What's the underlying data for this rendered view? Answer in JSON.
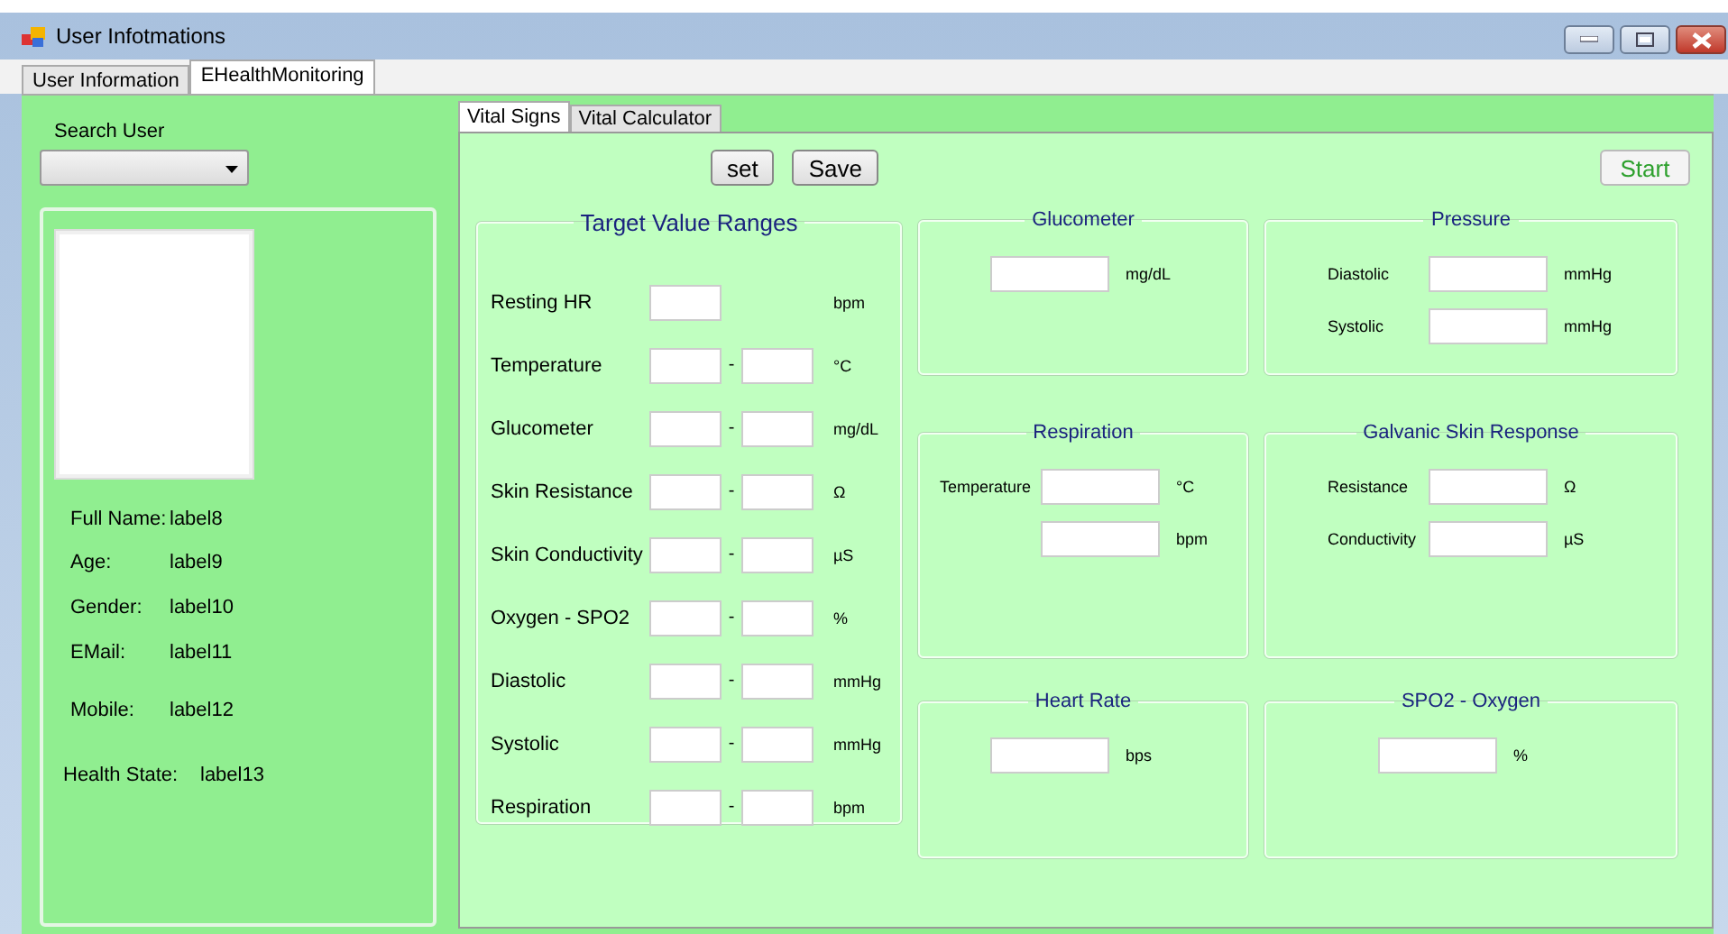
{
  "window": {
    "title": "User Infotmations",
    "controls": [
      {
        "kind": "minimize"
      },
      {
        "kind": "maximize"
      },
      {
        "kind": "close"
      }
    ]
  },
  "tabs": [
    {
      "label": "User Information",
      "selected": false
    },
    {
      "label": "EHealthMonitoring",
      "selected": true
    }
  ],
  "user_panel": {
    "search_label": "Search User",
    "info": [
      {
        "label": "Full Name:",
        "value": "label8"
      },
      {
        "label": "Age:",
        "value": "label9"
      },
      {
        "label": "Gender:",
        "value": "label10"
      },
      {
        "label": "EMail:",
        "value": "label11"
      },
      {
        "label": "Mobile:",
        "value": "label12"
      },
      {
        "label": "Health State:",
        "value": "label13"
      }
    ]
  },
  "inner_tabs": [
    {
      "label": "Vital Signs",
      "selected": true
    },
    {
      "label": "Vital Calculator",
      "selected": false
    }
  ],
  "buttons": [
    {
      "label": "set",
      "kind": "action"
    },
    {
      "label": "Save",
      "kind": "action"
    },
    {
      "label": "Start",
      "kind": "start"
    }
  ],
  "target_ranges": {
    "title": "Target Value Ranges",
    "rows": [
      {
        "label": "Resting HR",
        "kind": "single",
        "unit": "bpm"
      },
      {
        "label": "Temperature",
        "kind": "range",
        "unit": "°C"
      },
      {
        "label": "Glucometer",
        "kind": "range",
        "unit": "mg/dL"
      },
      {
        "label": "Skin Resistance",
        "kind": "range",
        "unit": "Ω"
      },
      {
        "label": "Skin Conductivity",
        "kind": "range",
        "unit": "µS"
      },
      {
        "label": "Oxygen - SPO2",
        "kind": "range",
        "unit": "%"
      },
      {
        "label": "Diastolic",
        "kind": "range",
        "unit": "mmHg"
      },
      {
        "label": "Systolic",
        "kind": "range",
        "unit": "mmHg"
      },
      {
        "label": "Respiration",
        "kind": "range",
        "unit": "bpm"
      }
    ],
    "separator": "-"
  },
  "groups": [
    {
      "title": "Glucometer",
      "fields": [
        {
          "unit": "mg/dL"
        }
      ]
    },
    {
      "title": "Pressure",
      "fields": [
        {
          "label": "Diastolic",
          "unit": "mmHg"
        },
        {
          "label": "Systolic",
          "unit": "mmHg"
        }
      ]
    },
    {
      "title": "Respiration",
      "fields": [
        {
          "label": "Temperature",
          "unit": "°C"
        },
        {
          "unit": "bpm"
        }
      ]
    },
    {
      "title": "Galvanic Skin Response",
      "fields": [
        {
          "label": "Resistance",
          "unit": "Ω"
        },
        {
          "label": "Conductivity",
          "unit": "µS"
        }
      ]
    },
    {
      "title": "Heart Rate",
      "fields": [
        {
          "unit": "bps"
        }
      ]
    },
    {
      "title": "SPO2 - Oxygen",
      "fields": [
        {
          "unit": "%"
        }
      ]
    }
  ]
}
